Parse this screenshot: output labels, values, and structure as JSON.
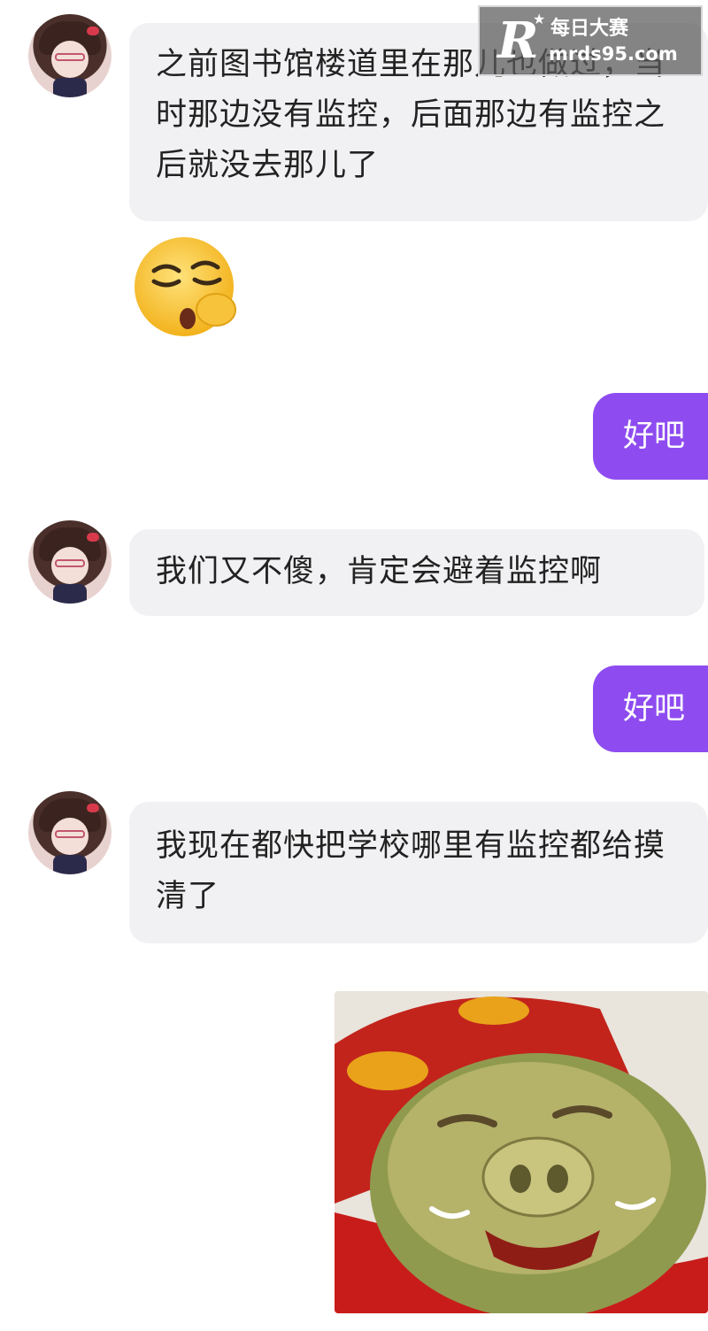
{
  "messages": [
    {
      "side": "in",
      "text": "之前图书馆楼道里在那儿也做过，当时那边没有监控，后面那边有监控之后就没去那儿了"
    },
    {
      "side": "in",
      "emoji": "shushing-face-emoji"
    },
    {
      "side": "out",
      "text": "好吧"
    },
    {
      "side": "in",
      "text": "我们又不傻，肯定会避着监控啊"
    },
    {
      "side": "out",
      "text": "好吧"
    },
    {
      "side": "in",
      "text": "我现在都快把学校哪里有监控都给摸清了"
    },
    {
      "side": "out",
      "sticker": "crying-pig-sticker"
    }
  ],
  "watermark": {
    "brand": "每日大赛",
    "url": "mrds95.com",
    "logo_letter": "R"
  },
  "colors": {
    "outgoing_bubble": "#8e4cf0",
    "incoming_bubble": "#f1f1f3",
    "background": "#ffffff"
  }
}
